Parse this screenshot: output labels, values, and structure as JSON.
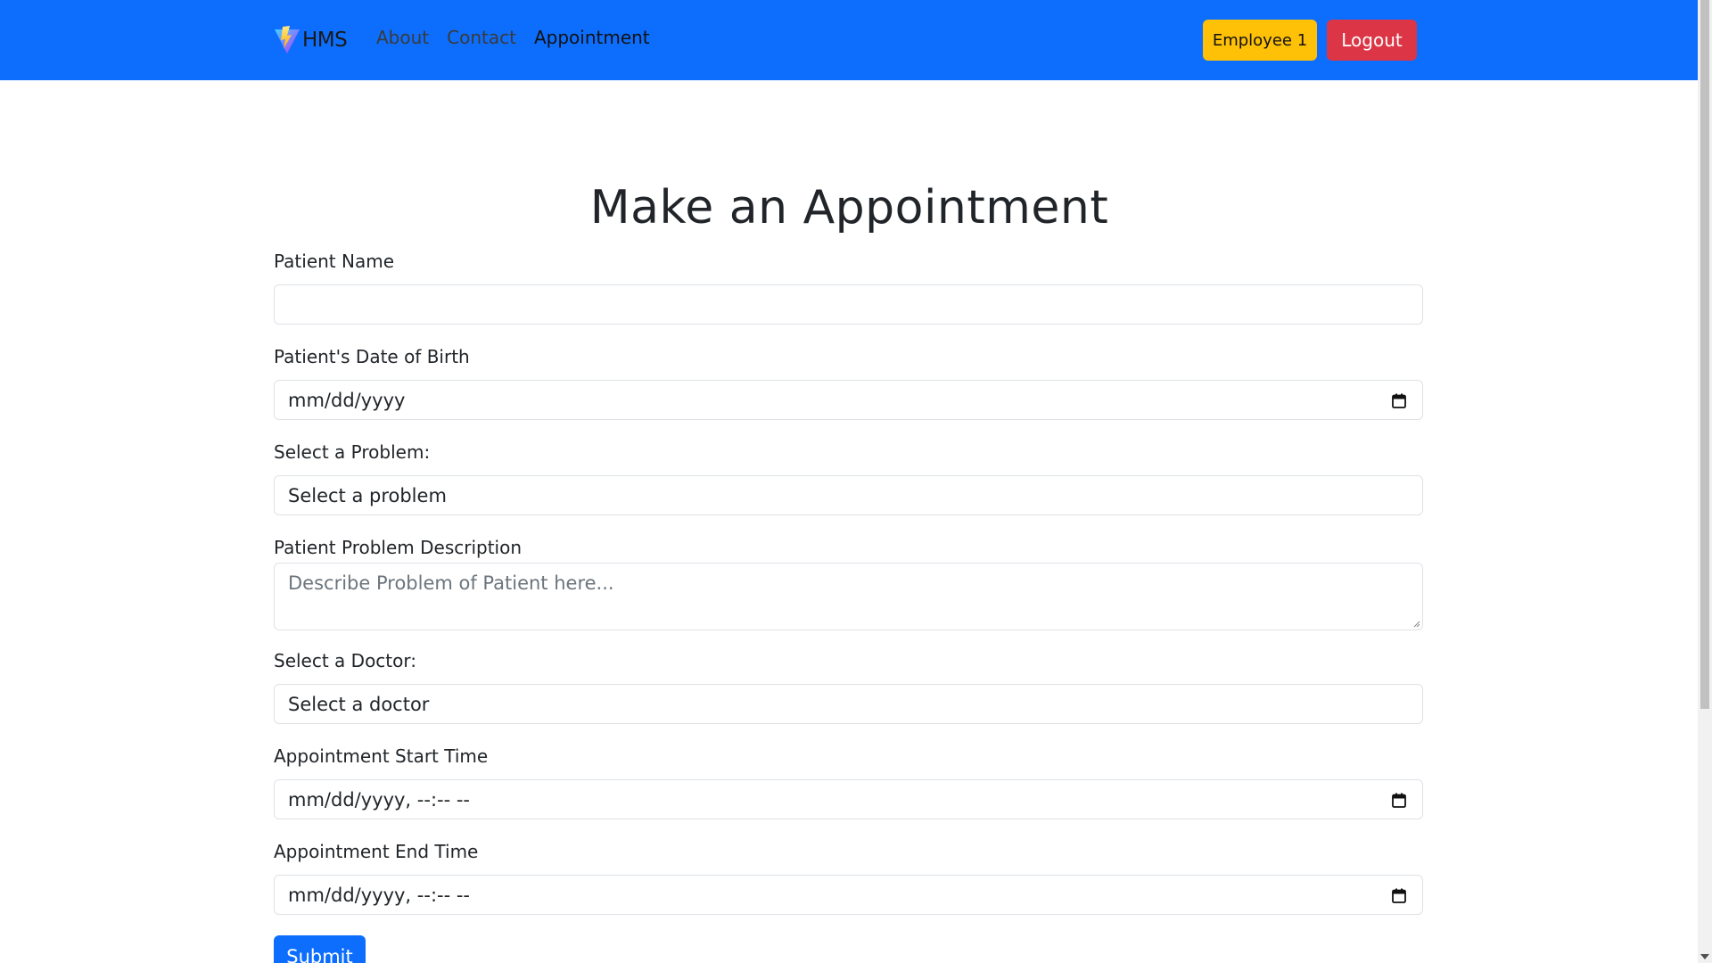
{
  "navbar": {
    "brand": "HMS",
    "links": [
      {
        "label": "About"
      },
      {
        "label": "Contact"
      },
      {
        "label": "Appointment"
      }
    ],
    "employee_button": "Employee 1",
    "logout_button": "Logout"
  },
  "icons": {
    "logo": "vite-logo-icon",
    "calendar": "calendar-icon"
  },
  "colors": {
    "navbar_bg": "#0d6efd",
    "employee_bg": "#ffc107",
    "logout_bg": "#dc3545",
    "submit_bg": "#0d6efd"
  },
  "form": {
    "title": "Make an Appointment",
    "patient_name": {
      "label": "Patient Name",
      "value": ""
    },
    "dob": {
      "label": "Patient's Date of Birth",
      "value": "mm/dd/yyyy"
    },
    "problem": {
      "label": "Select a Problem:",
      "value": "Select a problem"
    },
    "description": {
      "label": "Patient Problem Description",
      "placeholder": "Describe Problem of Patient here..."
    },
    "doctor": {
      "label": "Select a Doctor:",
      "value": "Select a doctor"
    },
    "start_time": {
      "label": "Appointment Start Time",
      "value": "mm/dd/yyyy, --:-- --"
    },
    "end_time": {
      "label": "Appointment End Time",
      "value": "mm/dd/yyyy, --:-- --"
    },
    "submit": "Submit"
  }
}
